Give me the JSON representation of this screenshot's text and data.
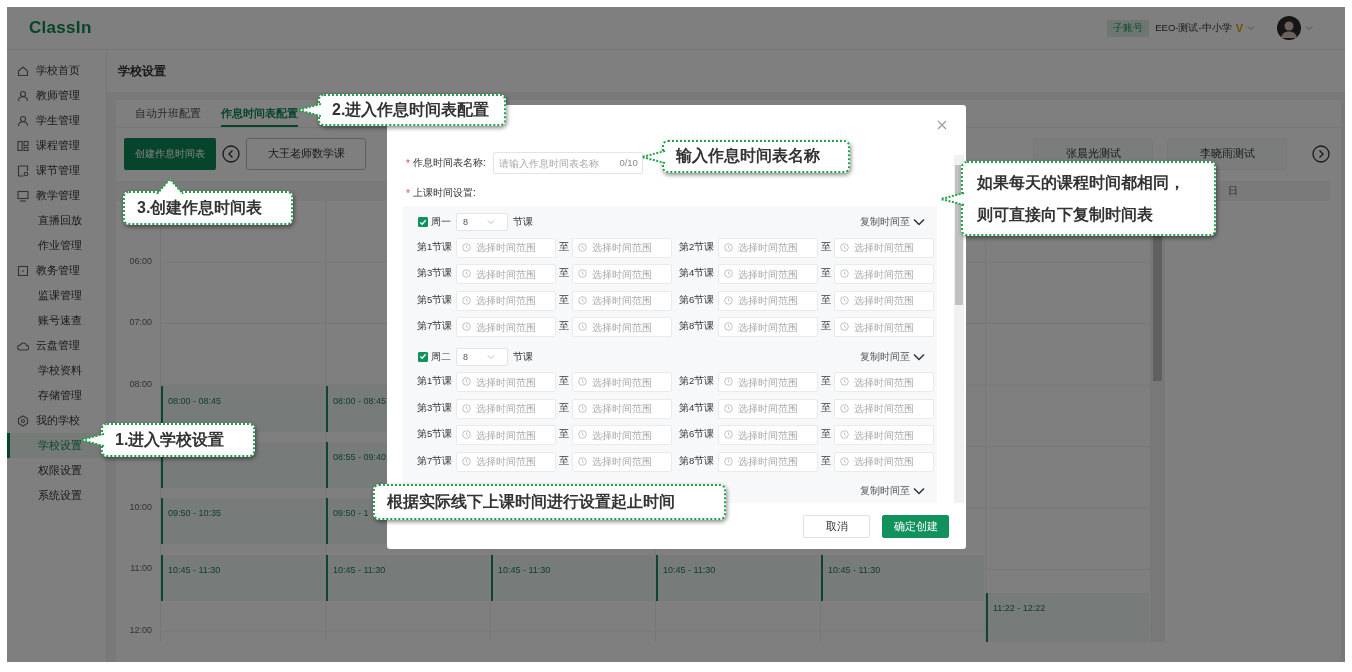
{
  "header": {
    "logo": "ClassIn",
    "account_badge": "子账号",
    "school": "EEO-测试-中小学",
    "vip_mark": "V"
  },
  "sidebar": {
    "items": [
      {
        "label": "学校首页",
        "kind": "home",
        "selected": false
      },
      {
        "label": "教师管理",
        "kind": "person",
        "selected": false
      },
      {
        "label": "学生管理",
        "kind": "person",
        "selected": false
      },
      {
        "label": "课程管理",
        "kind": "grid",
        "selected": false
      },
      {
        "label": "课节管理",
        "kind": "doc",
        "selected": false
      },
      {
        "label": "教学管理",
        "kind": "monitor",
        "selected": false,
        "children": [
          {
            "label": "直播回放",
            "selected": false
          },
          {
            "label": "作业管理",
            "selected": false
          }
        ]
      },
      {
        "label": "教务管理",
        "kind": "square",
        "selected": false,
        "children": [
          {
            "label": "监课管理",
            "selected": false
          },
          {
            "label": "账号速查",
            "selected": false
          }
        ]
      },
      {
        "label": "云盘管理",
        "kind": "cloud",
        "selected": false,
        "children": [
          {
            "label": "学校资料",
            "selected": false
          },
          {
            "label": "存储管理",
            "selected": false
          }
        ]
      },
      {
        "label": "我的学校",
        "kind": "hexagon",
        "selected": false,
        "children": [
          {
            "label": "学校设置",
            "selected": true
          },
          {
            "label": "权限设置",
            "selected": false
          },
          {
            "label": "系统设置",
            "selected": false
          }
        ]
      }
    ]
  },
  "page_title": "学校设置",
  "tabs": [
    {
      "label": "自动升班配置",
      "selected": false
    },
    {
      "label": "作息时间表配置",
      "selected": true
    }
  ],
  "create_button": "创建作息时间表",
  "timetables": {
    "first": [
      {
        "label": "大王老师数学课",
        "selected": true
      }
    ],
    "last": [
      {
        "label": "张晨光测试",
        "selected": false
      },
      {
        "label": "李晓雨测试",
        "selected": false
      }
    ]
  },
  "calendar": {
    "day_headers": [
      {
        "kind": "covered"
      },
      {
        "kind": "covered"
      },
      {
        "kind": "covered"
      },
      {
        "kind": "covered"
      },
      {
        "kind": "covered"
      },
      {
        "kind": "covered"
      },
      {
        "kind": "shown",
        "label": "日"
      }
    ],
    "hours": [
      {
        "kind": "shown",
        "label": "06:00"
      },
      {
        "kind": "shown",
        "label": "07:00"
      },
      {
        "kind": "shown",
        "label": "08:00"
      },
      {
        "kind": "covered"
      },
      {
        "kind": "shown",
        "label": "10:00"
      },
      {
        "kind": "shown",
        "label": "11:00"
      },
      {
        "kind": "shown",
        "label": "12:00"
      }
    ],
    "columns": [
      {
        "events": [
          {
            "kind": "class",
            "time": "08:00 - 08:45"
          },
          {
            "kind": "class"
          },
          {
            "kind": "class",
            "time": "09:50 - 10:35"
          },
          {
            "kind": "class",
            "time": "10:45 - 11:30"
          }
        ]
      },
      {
        "events": [
          {
            "kind": "class",
            "time": "08:00 - 08:45"
          },
          {
            "kind": "class",
            "time": "08:55 - 09:40"
          },
          {
            "kind": "class",
            "time": "09:50 - 1"
          },
          {
            "kind": "class",
            "time": "10:45 - 11:30"
          }
        ]
      },
      {
        "events": [
          {
            "kind": "class",
            "time": "10:45 - 11:30"
          }
        ]
      },
      {
        "events": [
          {
            "kind": "class",
            "time": "10:45 - 11:30"
          }
        ]
      },
      {
        "events": [
          {
            "kind": "class",
            "time": "10:45 - 11:30"
          }
        ]
      },
      {
        "events": [
          {
            "kind": "class",
            "time": "11:22 - 12:22"
          }
        ]
      }
    ]
  },
  "dialog": {
    "required_mark": "*",
    "name_label": "作息时间表名称:",
    "name_field": {
      "placeholder": "请输入作息时间表名称",
      "counter": "0/10"
    },
    "schedule_label": "上课时间设置:",
    "days": [
      {
        "day": "周一",
        "checked": true,
        "count": "8",
        "unit": "节课",
        "copy": "复制时间至",
        "lessons": [
          {
            "label": "第1节课",
            "from": {
              "placeholder": "选择时间范围"
            },
            "separator": "至",
            "to": {
              "placeholder": "选择时间范围"
            }
          },
          {
            "label": "第2节课",
            "from": {
              "placeholder": "选择时间范围"
            },
            "separator": "至",
            "to": {
              "placeholder": "选择时间范围"
            }
          },
          {
            "label": "第3节课",
            "from": {
              "placeholder": "选择时间范围"
            },
            "separator": "至",
            "to": {
              "placeholder": "选择时间范围"
            }
          },
          {
            "label": "第4节课",
            "from": {
              "placeholder": "选择时间范围"
            },
            "separator": "至",
            "to": {
              "placeholder": "选择时间范围"
            }
          },
          {
            "label": "第5节课",
            "from": {
              "placeholder": "选择时间范围"
            },
            "separator": "至",
            "to": {
              "placeholder": "选择时间范围"
            }
          },
          {
            "label": "第6节课",
            "from": {
              "placeholder": "选择时间范围"
            },
            "separator": "至",
            "to": {
              "placeholder": "选择时间范围"
            }
          },
          {
            "label": "第7节课",
            "from": {
              "placeholder": "选择时间范围"
            },
            "separator": "至",
            "to": {
              "placeholder": "选择时间范围"
            }
          },
          {
            "label": "第8节课",
            "from": {
              "placeholder": "选择时间范围"
            },
            "separator": "至",
            "to": {
              "placeholder": "选择时间范围"
            }
          }
        ]
      },
      {
        "day": "周二",
        "checked": true,
        "count": "8",
        "unit": "节课",
        "copy": "复制时间至",
        "lessons": [
          {
            "label": "第1节课",
            "from": {
              "placeholder": "选择时间范围"
            },
            "separator": "至",
            "to": {
              "placeholder": "选择时间范围"
            }
          },
          {
            "label": "第2节课",
            "from": {
              "placeholder": "选择时间范围"
            },
            "separator": "至",
            "to": {
              "placeholder": "选择时间范围"
            }
          },
          {
            "label": "第3节课",
            "from": {
              "placeholder": "选择时间范围"
            },
            "separator": "至",
            "to": {
              "placeholder": "选择时间范围"
            }
          },
          {
            "label": "第4节课",
            "from": {
              "placeholder": "选择时间范围"
            },
            "separator": "至",
            "to": {
              "placeholder": "选择时间范围"
            }
          },
          {
            "label": "第5节课",
            "from": {
              "placeholder": "选择时间范围"
            },
            "separator": "至",
            "to": {
              "placeholder": "选择时间范围"
            }
          },
          {
            "label": "第6节课",
            "from": {
              "placeholder": "选择时间范围"
            },
            "separator": "至",
            "to": {
              "placeholder": "选择时间范围"
            }
          },
          {
            "label": "第7节课",
            "from": {
              "placeholder": "选择时间范围"
            },
            "separator": "至",
            "to": {
              "placeholder": "选择时间范围"
            }
          },
          {
            "label": "第8节课",
            "from": {
              "placeholder": "选择时间范围"
            },
            "separator": "至",
            "to": {
              "placeholder": "选择时间范围"
            }
          }
        ]
      },
      {
        "copy": "复制时间至"
      }
    ],
    "buttons": [
      {
        "label": "取消",
        "kind": "secondary"
      },
      {
        "label": "确定创建",
        "kind": "primary"
      }
    ]
  },
  "callouts": [
    {
      "text": "2.进入作息时间表配置"
    },
    {
      "text": "3.创建作息时间表"
    },
    {
      "text": "输入作息时间表名称"
    },
    {
      "lines": [
        "如果每天的课程时间都相同，",
        "则可直接向下复制时间表"
      ]
    },
    {
      "text": "1.进入学校设置"
    },
    {
      "text": "根据实际线下上课时间进行设置起止时间"
    }
  ]
}
